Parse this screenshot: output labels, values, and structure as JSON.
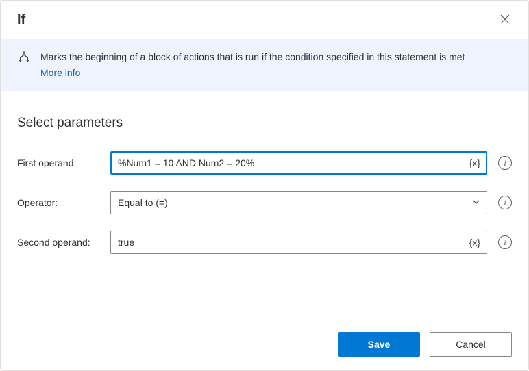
{
  "header": {
    "title": "If"
  },
  "info": {
    "description": "Marks the beginning of a block of actions that is run if the condition specified in this statement is met",
    "more_label": "More info"
  },
  "params": {
    "title": "Select parameters",
    "first_operand": {
      "label": "First operand:",
      "value": "%Num1 = 10 AND Num2 = 20%",
      "var_badge": "{x}"
    },
    "operator": {
      "label": "Operator:",
      "value": "Equal to (=)"
    },
    "second_operand": {
      "label": "Second operand:",
      "value": "true",
      "var_badge": "{x}"
    }
  },
  "footer": {
    "save": "Save",
    "cancel": "Cancel"
  }
}
